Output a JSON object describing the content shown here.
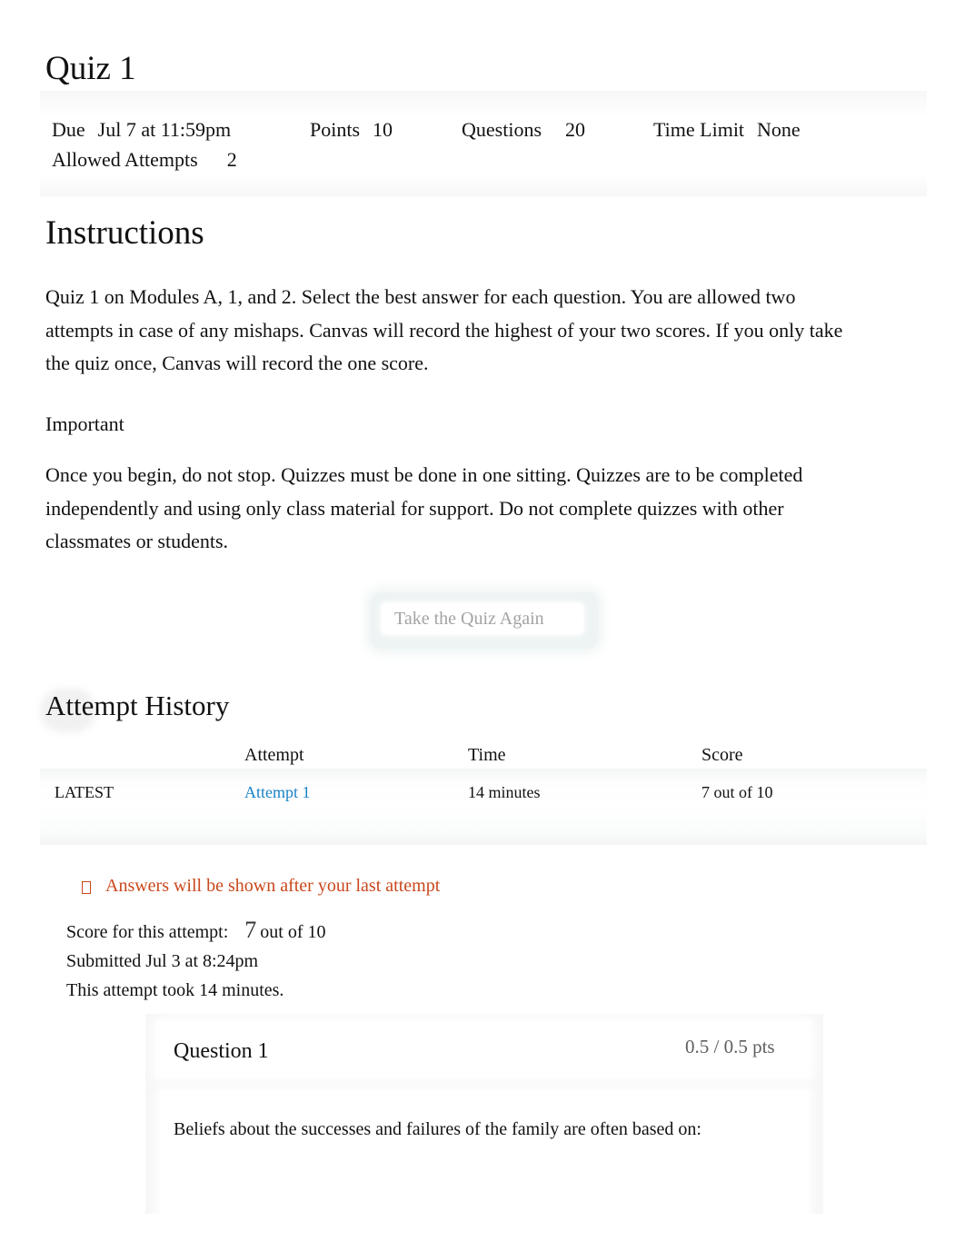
{
  "quiz": {
    "title": "Quiz 1",
    "meta": {
      "due_label": "Due",
      "due_value": "Jul 7 at 11:59pm",
      "points_label": "Points",
      "points_value": "10",
      "questions_label": "Questions",
      "questions_value": "20",
      "time_limit_label": "Time Limit",
      "time_limit_value": "None",
      "allowed_attempts_label": "Allowed Attempts",
      "allowed_attempts_value": "2"
    }
  },
  "instructions": {
    "heading": "Instructions",
    "paragraph1": "Quiz 1 on Modules A, 1, and 2. Select the best answer for each question. You are allowed two attempts in case of any mishaps. Canvas will record the highest of your two scores. If you only take the quiz once, Canvas will record the one score.",
    "important_label": "Important",
    "paragraph2": "Once you begin, do not stop. Quizzes must be done in one sitting. Quizzes are to be completed independently and using only class material for support. Do not complete quizzes with other classmates or students."
  },
  "actions": {
    "take_again_label": "Take the Quiz Again"
  },
  "attempt_history": {
    "heading": "Attempt History",
    "columns": [
      "",
      "Attempt",
      "Time",
      "Score"
    ],
    "rows": [
      {
        "tag": "LATEST",
        "attempt": "Attempt 1",
        "time": "14 minutes",
        "score": "7 out of 10"
      }
    ]
  },
  "attempt_detail": {
    "warning_icon": "warning-icon",
    "warning_text": "Answers will be shown after your last attempt",
    "score_label": "Score for this attempt:",
    "score_value": "7",
    "score_suffix": "out of 10",
    "submitted": "Submitted Jul 3 at 8:24pm",
    "duration": "This attempt took 14 minutes."
  },
  "questions": [
    {
      "title": "Question 1",
      "points": "0.5 / 0.5 pts",
      "text": "Beliefs about the successes and failures of the family are often based on:"
    }
  ],
  "colors": {
    "link": "#1a83c7",
    "warning": "#c9471c",
    "muted": "#a3a3a3"
  }
}
